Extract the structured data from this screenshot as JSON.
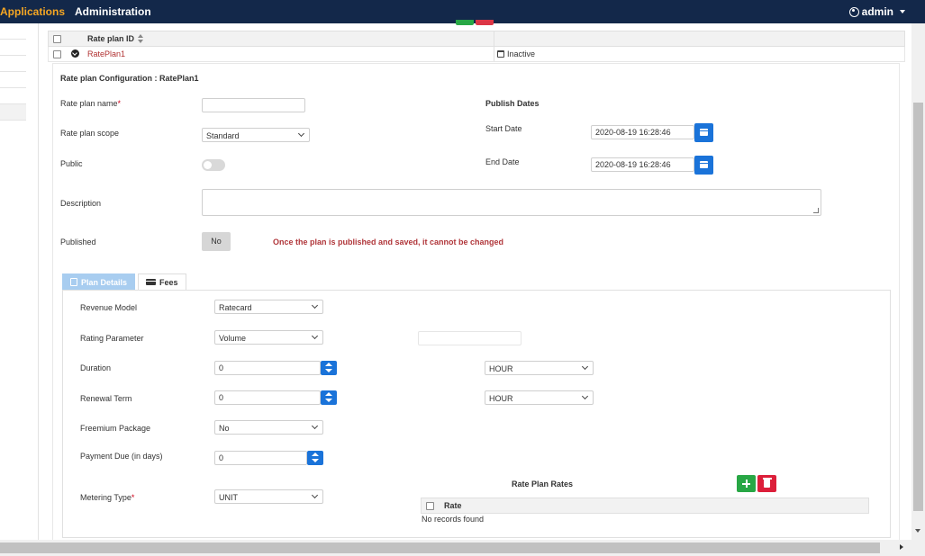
{
  "nav": {
    "applications": "Applications",
    "administration": "Administration",
    "user": "admin"
  },
  "table": {
    "header": "Rate plan ID",
    "rows": [
      {
        "id": "RatePlan1",
        "status": "Inactive"
      }
    ]
  },
  "config": {
    "title": "Rate plan Configuration : RatePlan1",
    "name_label": "Rate plan name",
    "required_mark": "*",
    "name_value": "",
    "scope_label": "Rate plan scope",
    "scope_value": "Standard",
    "public_label": "Public",
    "public_on": false,
    "description_label": "Description",
    "description_value": "",
    "published_label": "Published",
    "published_value": "No",
    "warning": "Once the plan is published and saved, it cannot be changed",
    "publish_dates_heading": "Publish Dates",
    "start_date_label": "Start Date",
    "start_date_value": "2020-08-19 16:28:46",
    "end_date_label": "End Date",
    "end_date_value": "2020-08-19 16:28:46"
  },
  "tabs": [
    {
      "label": "Plan Details",
      "active": true,
      "icon": "calculator-icon"
    },
    {
      "label": "Fees",
      "active": false,
      "icon": "credit-card-icon"
    }
  ],
  "plan_details": {
    "revenue_model_label": "Revenue Model",
    "revenue_model_value": "Ratecard",
    "rating_param_label": "Rating Parameter",
    "rating_param_value": "Volume",
    "rating_param_extra": "",
    "duration_label": "Duration",
    "duration_value": "0",
    "duration_unit": "HOUR",
    "renewal_label": "Renewal Term",
    "renewal_value": "0",
    "renewal_unit": "HOUR",
    "freemium_label": "Freemium Package",
    "freemium_value": "No",
    "payment_due_label": "Payment Due (in days)",
    "payment_due_value": "0",
    "metering_label": "Metering Type",
    "metering_value": "UNIT"
  },
  "rates": {
    "title": "Rate Plan Rates",
    "column": "Rate",
    "empty": "No records found"
  },
  "colors": {
    "nav_bg": "#13284a",
    "nav_accent": "#f5a623",
    "primary": "#1a73d9",
    "success": "#28a745",
    "danger": "#dc1f3a",
    "tab_active": "#a8cdf0"
  }
}
